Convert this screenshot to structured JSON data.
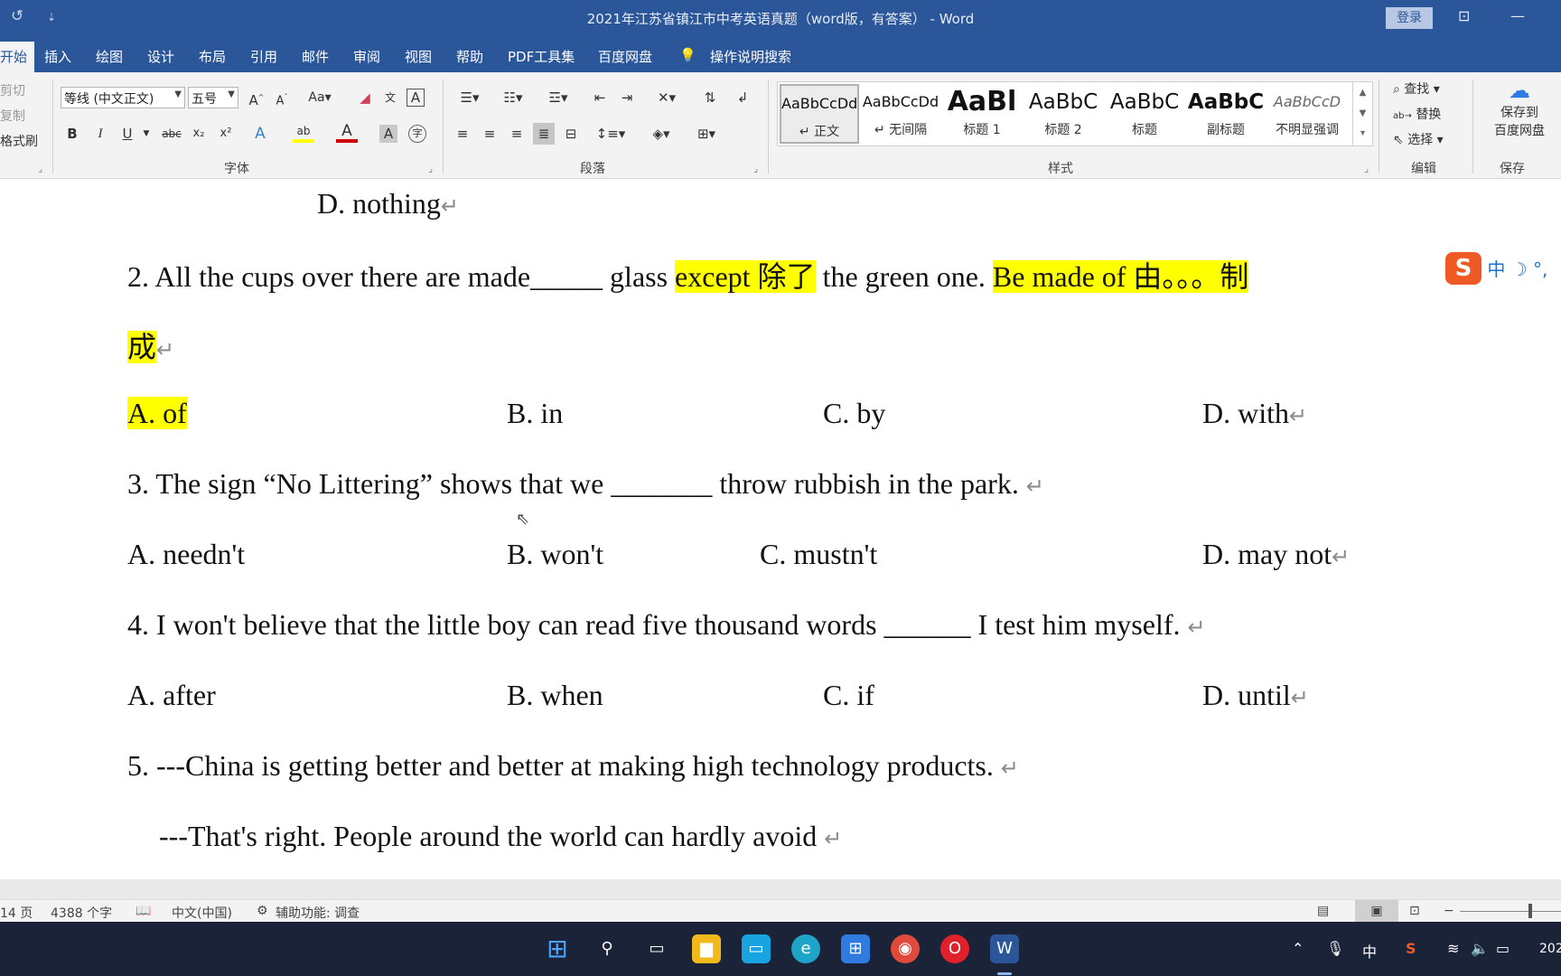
{
  "titlebar": {
    "title": "2021年江苏省镇江市中考英语真题（word版，有答案） - Word",
    "login_label": "登录",
    "undo_icon": "↺",
    "customize_icon": "⇣",
    "ribbon_display_icon": "⊡",
    "minimize_icon": "—"
  },
  "tabs": [
    "开始",
    "插入",
    "绘图",
    "设计",
    "布局",
    "引用",
    "邮件",
    "审阅",
    "视图",
    "帮助",
    "PDF工具集",
    "百度网盘"
  ],
  "tell_me": "操作说明搜索",
  "ribbon": {
    "clipboard": {
      "cut": "剪切",
      "copy": "复制",
      "format_painter": "格式刷"
    },
    "font": {
      "font_name": "等线 (中文正文)",
      "font_size": "五号",
      "group_label": "字体"
    },
    "paragraph": {
      "group_label": "段落"
    },
    "styles": {
      "group_label": "样式",
      "items": [
        {
          "preview": "AaBbCcDd",
          "name": "↵ 正文"
        },
        {
          "preview": "AaBbCcDd",
          "name": "↵ 无间隔"
        },
        {
          "preview": "AaBl",
          "name": "标题 1"
        },
        {
          "preview": "AaBbC",
          "name": "标题 2"
        },
        {
          "preview": "AaBbC",
          "name": "标题"
        },
        {
          "preview": "AaBbC",
          "name": "副标题"
        },
        {
          "preview": "AaBbCcD",
          "name": "不明显强调"
        }
      ]
    },
    "editing": {
      "find": "查找",
      "replace": "替换",
      "select": "选择",
      "group_label": "编辑"
    },
    "save": {
      "label_line1": "保存到",
      "label_line2": "百度网盘",
      "group_label": "保存"
    }
  },
  "document": {
    "lines": {
      "l1": "D. nothing",
      "q2_a": "2. All the cups over there are made_____ glass ",
      "q2_hl1": "except 除了",
      "q2_b": "  the green one. ",
      "q2_hl2": "Be made of 由。。。制",
      "q2_hl3": "成",
      "q2_opt_a": "A. of",
      "q2_opt_b": "B. in",
      "q2_opt_c": "C. by",
      "q2_opt_d": "D. with",
      "q3": "3. The sign “No Littering” shows that we _______ throw rubbish in the park.",
      "q3_opt_a": "A. needn't",
      "q3_opt_b": "B. won't",
      "q3_opt_c": "C. mustn't",
      "q3_opt_d": "D. may not",
      "q4": "4. I won't believe that the little boy can read five thousand words ______ I test him myself.",
      "q4_opt_a": "A. after",
      "q4_opt_b": "B. when",
      "q4_opt_c": "C. if",
      "q4_opt_d": "D. until",
      "q5": "5. ---China is getting better and better at making high technology products.",
      "q5_b": "---That's right. People around the world can hardly avoid"
    },
    "para_mark": "↵"
  },
  "ime": {
    "logo": "S",
    "mode": "中",
    "moon": "☽",
    "punct": "°,"
  },
  "statusbar": {
    "page": "14 页",
    "words": "4388 个字",
    "language": "中文(中国)",
    "accessibility": "辅助功能: 调查"
  },
  "taskbar": {
    "tray_ime": "中",
    "clock": "202"
  },
  "colors": {
    "word_blue": "#2b579a",
    "highlight": "#ffff00",
    "taskbar": "#1b2338"
  }
}
